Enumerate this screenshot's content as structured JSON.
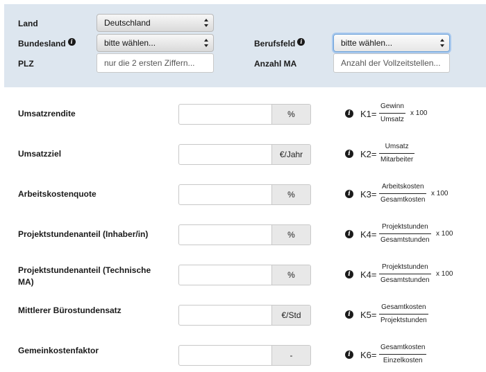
{
  "header": {
    "land": {
      "label": "Land",
      "value": "Deutschland"
    },
    "bundesland": {
      "label": "Bundesland",
      "value": "bitte wählen..."
    },
    "berufsfeld": {
      "label": "Berufsfeld",
      "value": "bitte wählen..."
    },
    "plz": {
      "label": "PLZ",
      "placeholder": "nur die 2 ersten Ziffern..."
    },
    "anzahl_ma": {
      "label": "Anzahl MA",
      "placeholder": "Anzahl der Vollzeitstellen..."
    },
    "info_icon": "info-icon"
  },
  "rows": [
    {
      "label": "Umsatzrendite",
      "unit": "%",
      "formula": {
        "k": "K1=",
        "num": "Gewinn",
        "den": "Umsatz",
        "mult": "x 100"
      }
    },
    {
      "label": "Umsatzziel",
      "unit": "€/Jahr",
      "formula": {
        "k": "K2=",
        "num": "Umsatz",
        "den": "Mitarbeiter",
        "mult": ""
      }
    },
    {
      "label": "Arbeitskostenquote",
      "unit": "%",
      "formula": {
        "k": "K3=",
        "num": "Arbeitskosten",
        "den": "Gesamtkosten",
        "mult": "x 100"
      }
    },
    {
      "label": "Projektstundenanteil (Inhaber/in)",
      "unit": "%",
      "formula": {
        "k": "K4=",
        "num": "Projektstunden",
        "den": "Gesamtstunden",
        "mult": "x 100"
      }
    },
    {
      "label": "Projektstundenanteil (Technische MA)",
      "unit": "%",
      "formula": {
        "k": "K4=",
        "num": "Projektstunden",
        "den": "Gesamtstunden",
        "mult": "x 100"
      }
    },
    {
      "label": "Mittlerer Bürostundensatz",
      "unit": "€/Std",
      "formula": {
        "k": "K5=",
        "num": "Gesamtkosten",
        "den": "Projektstunden",
        "mult": ""
      }
    },
    {
      "label": "Gemeinkostenfaktor",
      "unit": "-",
      "formula": {
        "k": "K6=",
        "num": "Gesamtkosten",
        "den": "Einzelkosten",
        "mult": ""
      }
    }
  ]
}
